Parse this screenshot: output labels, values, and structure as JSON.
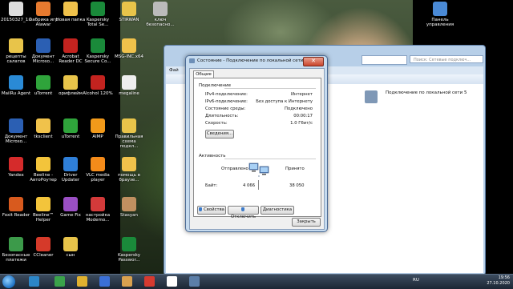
{
  "desktop_icons": [
    {
      "id": "i1",
      "label": "20150327_1..."
    },
    {
      "id": "i2",
      "label": "Фабрика игр Alawar"
    },
    {
      "id": "i3",
      "label": "Новая папка"
    },
    {
      "id": "i4",
      "label": "Kaspersky Total Se..."
    },
    {
      "id": "i5",
      "label": "STIRWAN"
    },
    {
      "id": "i6",
      "label": "ключ безопасно..."
    },
    {
      "id": "i7",
      "label": "рецепты салатов"
    },
    {
      "id": "i8",
      "label": "Документ Microso..."
    },
    {
      "id": "i9",
      "label": "Acrobat Reader DC"
    },
    {
      "id": "i10",
      "label": "Kaspersky Secure Co..."
    },
    {
      "id": "i11",
      "label": "MSG-INC.x64"
    },
    {
      "id": "i12",
      "label": "MailRu Agent"
    },
    {
      "id": "i13",
      "label": "uTorrent"
    },
    {
      "id": "i14",
      "label": "орифлейм"
    },
    {
      "id": "i15",
      "label": "Alcohol 120%"
    },
    {
      "id": "i16",
      "label": "megaline"
    },
    {
      "id": "i17",
      "label": "Документ Microso..."
    },
    {
      "id": "i18",
      "label": "tksclient"
    },
    {
      "id": "i19",
      "label": "uTorrent"
    },
    {
      "id": "i20",
      "label": "AIMP"
    },
    {
      "id": "i21",
      "label": "Правильная схема подкл..."
    },
    {
      "id": "i22",
      "label": "Yandex"
    },
    {
      "id": "i23",
      "label": "Beeline - АвтоРоутер"
    },
    {
      "id": "i24",
      "label": "Driver Updater"
    },
    {
      "id": "i25",
      "label": "VLC media player"
    },
    {
      "id": "i26",
      "label": "помощь в браузе..."
    },
    {
      "id": "i27",
      "label": "Foxit Reader"
    },
    {
      "id": "i28",
      "label": "Beeline™ Helper"
    },
    {
      "id": "i29",
      "label": "Game Fix"
    },
    {
      "id": "i30",
      "label": "настройка Modemo..."
    },
    {
      "id": "i31",
      "label": "Stasyan"
    },
    {
      "id": "i32",
      "label": "Безопасные платежи"
    },
    {
      "id": "i33",
      "label": "CCleaner"
    },
    {
      "id": "i34",
      "label": "сын"
    },
    {
      "id": "i35",
      "label": "Kaspersky Passwor..."
    },
    {
      "id": "i36",
      "label": "Панель управления"
    }
  ],
  "explorer": {
    "search_placeholder": "Поиск: Сетевые подключ...",
    "menu_file": "Фай",
    "connection": {
      "name": "Подключение по локальной сети 5",
      "line2": "5"
    }
  },
  "dialog": {
    "title": "Состояние - Подключение по локальной сети 6",
    "close_label": "✕",
    "tab": "Общие",
    "connection_group": "Подключение",
    "rows": [
      {
        "key": "IPv4-подключение:",
        "value": "Интернет"
      },
      {
        "key": "IPv6-подключение:",
        "value": "Без доступа к Интернету"
      },
      {
        "key": "Состояние среды:",
        "value": "Подключено"
      },
      {
        "key": "Длительность:",
        "value": "00:00:17"
      },
      {
        "key": "Скорость:",
        "value": "1.0 Гбит/с"
      }
    ],
    "details_button": "Сведения...",
    "activity_group": "Активность",
    "sent_label": "Отправлено",
    "received_label": "Принято",
    "bytes_label": "Байт:",
    "bytes_sent": "4 066",
    "bytes_received": "38 050",
    "properties_button": "Свойства",
    "disable_button": "Отключить",
    "diagnose_button": "Диагностика",
    "close_button": "Закрыть"
  },
  "tray": {
    "lang": "RU",
    "time": "19:56",
    "date": "27.10.2020"
  }
}
